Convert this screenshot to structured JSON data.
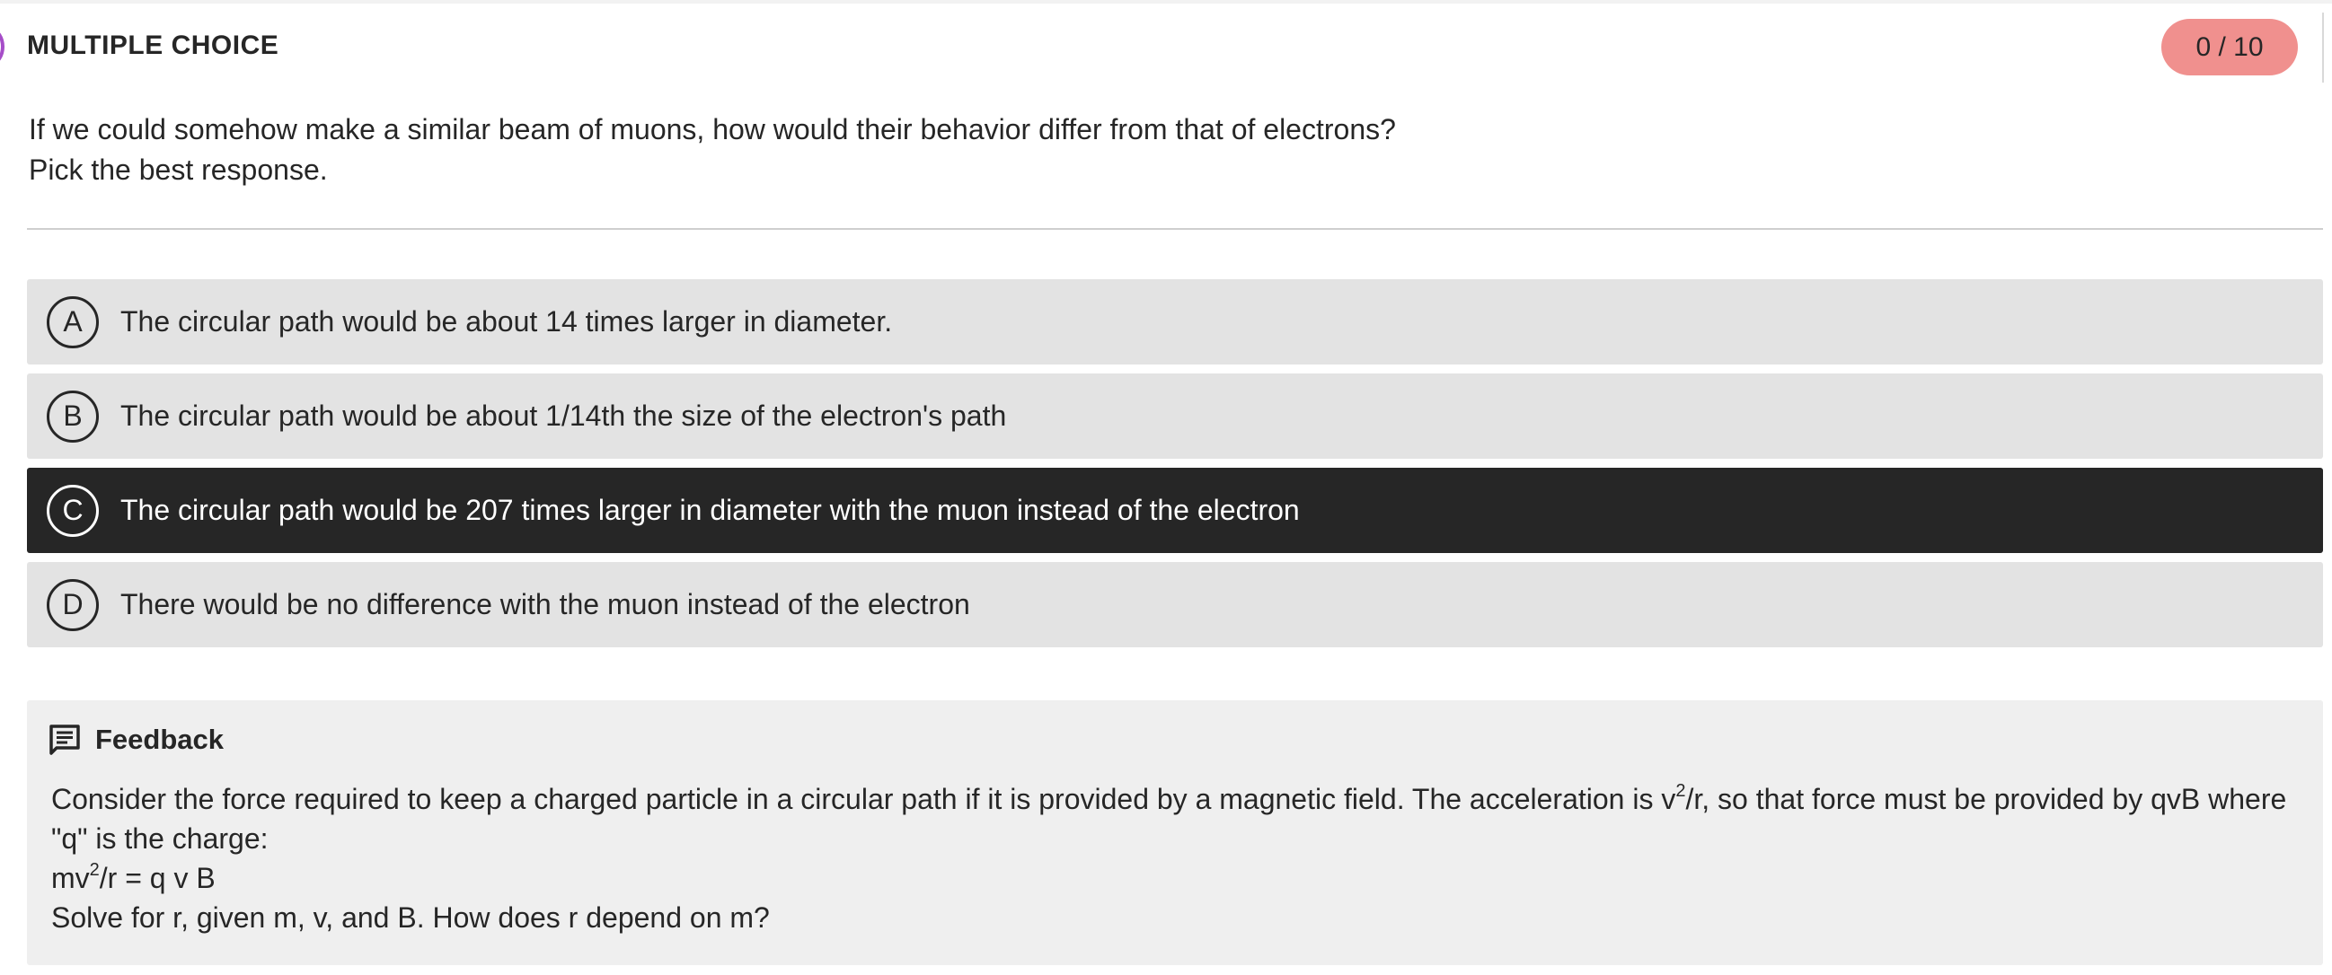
{
  "header": {
    "type_label": "MULTIPLE CHOICE",
    "score": "0 / 10"
  },
  "question": {
    "line1": "If we could somehow make a similar beam of muons, how would their behavior differ from that of electrons?",
    "line2": "Pick the best response."
  },
  "choices": [
    {
      "letter": "A",
      "text": "The circular path would be about 14 times larger in diameter.",
      "selected": false
    },
    {
      "letter": "B",
      "text": "The circular path would be about 1/14th the size of the electron's path",
      "selected": false
    },
    {
      "letter": "C",
      "text": "The circular path would be 207 times larger in diameter with the muon instead of the electron",
      "selected": true
    },
    {
      "letter": "D",
      "text": "There would be no difference with the muon instead of the electron",
      "selected": false
    }
  ],
  "feedback": {
    "title": "Feedback",
    "icon": "feedback-icon",
    "p1_a": "Consider the force required to keep a charged particle in a circular path if it is provided by a magnetic field. The acceleration is v",
    "p1_sup": "2",
    "p1_b": "/r, so that force must be provided by qvB where \"q\" is the charge:",
    "eq_a": "mv",
    "eq_sup": "2",
    "eq_b": "/r = q v B",
    "p3": "Solve for r, given m, v, and B. How does r depend on m?"
  },
  "colors": {
    "accent_marker": "#a64dc8",
    "score_badge": "#f0908e",
    "selected_choice": "#262626",
    "choice_bg": "#e3e3e3",
    "feedback_bg": "#efefef"
  }
}
